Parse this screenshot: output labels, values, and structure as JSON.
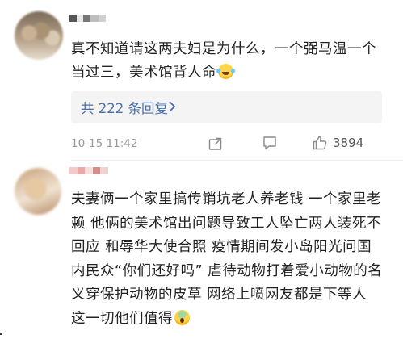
{
  "comments": [
    {
      "text": "真不知道请这两夫妇是为什么，一个弼马温一个当过三，美术馆背人命",
      "emoji": "laugh-cry-emoji",
      "replies_label": "共 222 条回复",
      "time": "10-15 11:42",
      "likes": "3894"
    },
    {
      "text": "夫妻俩一个家里搞传销坑老人养老钱 一个家里老赖 他俩的美术馆出问题导致工人坠亡两人装死不回应 和辱华大使合照 疫情期间发小岛阳光问国内民众“你们还好吗” 虐待动物打着爱小动物的名义穿保护动物的皮草 网络上喷网友都是下等人 这一切他们值得",
      "emoji": "scared-emoji"
    }
  ],
  "colors": {
    "link": "#4a6ea8",
    "meta": "#9a9a9a",
    "reply_bg": "#f4f4f4"
  }
}
